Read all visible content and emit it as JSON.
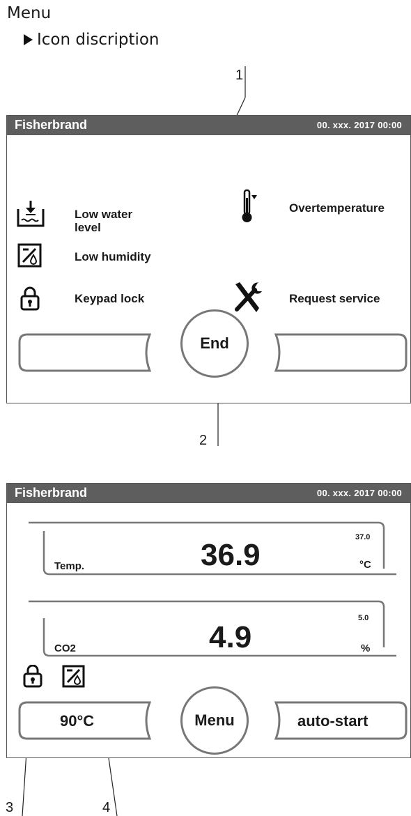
{
  "menu": {
    "title": "Menu",
    "subtitle": "Icon discription",
    "arrow_icon": "triangle-right-icon"
  },
  "callouts": [
    "1",
    "2",
    "3",
    "4"
  ],
  "screen1": {
    "brand": "Fisherbrand",
    "datetime": "00. xxx. 2017   00:00",
    "icons": [
      {
        "icon": "low-water-level-icon",
        "label": "Low water level"
      },
      {
        "icon": "low-humidity-icon",
        "label": "Low humidity"
      },
      {
        "icon": "keypad-lock-icon",
        "label": "Keypad lock"
      },
      {
        "icon": "overtemperature-icon",
        "label": "Overtemperature"
      },
      {
        "icon": "request-service-icon",
        "label": "Request service"
      }
    ],
    "center_button": "End"
  },
  "screen2": {
    "brand": "Fisherbrand",
    "datetime": "00. xxx. 2017   00:00",
    "temp": {
      "label": "Temp.",
      "value": "36.9",
      "setpoint": "37.0",
      "unit": "°C"
    },
    "co2": {
      "label": "CO2",
      "value": "4.9",
      "setpoint": "5.0",
      "unit": "%"
    },
    "status_icons": [
      "keypad-lock-icon",
      "low-humidity-icon"
    ],
    "left_button": "90°C",
    "center_button": "Menu",
    "right_button": "auto-start"
  },
  "colors": {
    "header_bar": "#5e5e5e",
    "outline": "#777777"
  }
}
